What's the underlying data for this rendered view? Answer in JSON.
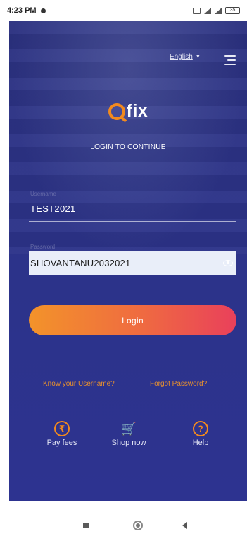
{
  "status_bar": {
    "time": "4:23 PM",
    "battery": "35"
  },
  "header": {
    "language": "English",
    "language_caret": "▼"
  },
  "branding": {
    "logo_text": "fix",
    "subtitle": "LOGIN TO CONTINUE"
  },
  "form": {
    "username_label": "Username",
    "username_value": "TEST2021",
    "password_label": "Password",
    "password_value": "SHOVANTANU2032021",
    "login_label": "Login"
  },
  "links": {
    "know_username": "Know your Username?",
    "forgot_password": "Forgot Password?"
  },
  "quick_actions": [
    {
      "label": "Pay fees",
      "icon": "rupee-icon",
      "glyph": "₹"
    },
    {
      "label": "Shop now",
      "icon": "cart-icon",
      "glyph": "🛒"
    },
    {
      "label": "Help",
      "icon": "help-icon",
      "glyph": "?"
    }
  ],
  "colors": {
    "background": "#2c3388",
    "accent": "#f28a1e",
    "button_start": "#f3932a",
    "button_end": "#e9405b"
  }
}
